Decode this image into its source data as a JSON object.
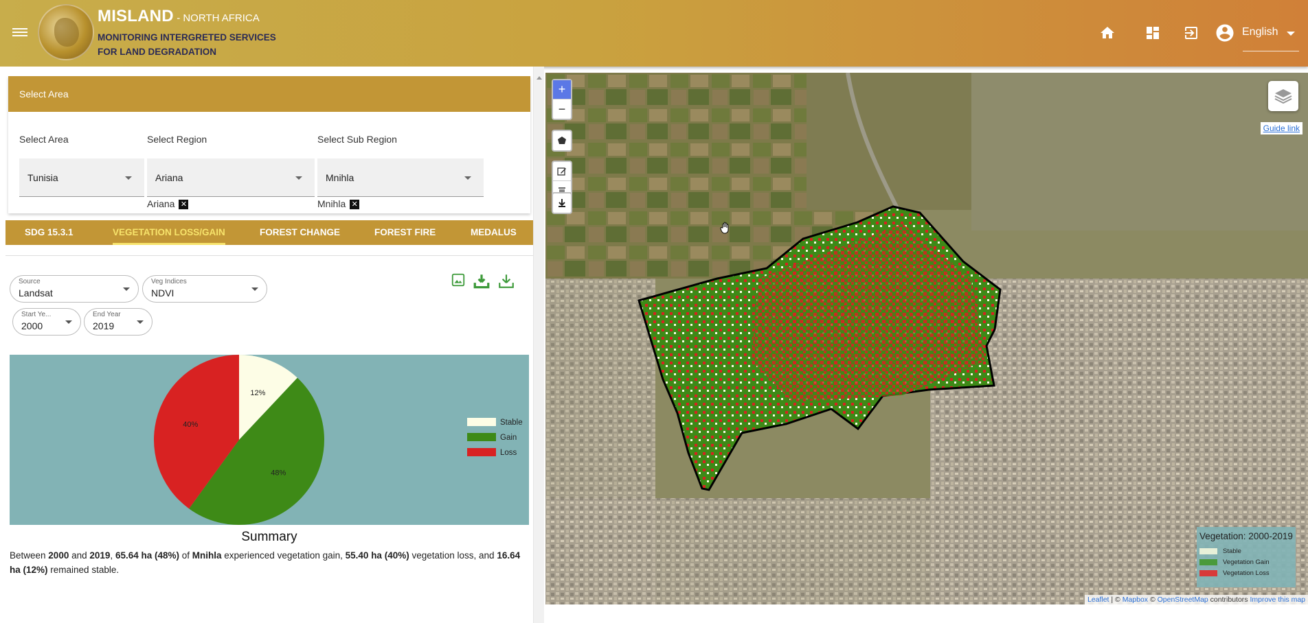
{
  "header": {
    "title": "MISLAND",
    "title_suffix": "- NORTH AFRICA",
    "subtitle_line1": "MONITORING INTERGRETED SERVICES",
    "subtitle_line2": "FOR LAND DEGRADATION",
    "icons": [
      "menu-icon",
      "home-icon",
      "dashboard-icon",
      "logout-icon",
      "account-icon"
    ],
    "language": "English"
  },
  "area_card": {
    "heading": "Select Area",
    "labels": {
      "area": "Select Area",
      "region": "Select Region",
      "sub_region": "Select Sub Region"
    },
    "values": {
      "area": "Tunisia",
      "region": "Ariana",
      "sub_region": "Mnihla"
    },
    "chips": {
      "region": "Ariana",
      "sub_region": "Mnihla"
    },
    "chip_close": "✕"
  },
  "tabs": [
    {
      "label": "SDG 15.3.1"
    },
    {
      "label": "VEGETATION LOSS/GAIN",
      "active": true
    },
    {
      "label": "FOREST CHANGE"
    },
    {
      "label": "FOREST FIRE"
    },
    {
      "label": "MEDALUS"
    }
  ],
  "filters": {
    "source": {
      "label": "Source",
      "value": "Landsat"
    },
    "veg_indices": {
      "label": "Veg Indices",
      "value": "NDVI"
    },
    "start_year": {
      "label": "Start Ye...",
      "value": "2000"
    },
    "end_year": {
      "label": "End Year",
      "value": "2019"
    }
  },
  "chart_data": {
    "type": "pie",
    "categories": [
      "Stable",
      "Gain",
      "Loss"
    ],
    "values": [
      12,
      48,
      40
    ],
    "labels": [
      "12%",
      "48%",
      "40%"
    ],
    "colors": [
      "#fdfde6",
      "#3e8a17",
      "#d82222"
    ],
    "legend_position": "right"
  },
  "summary": {
    "title": "Summary",
    "t1": "Between ",
    "b1": "2000",
    "t2": " and ",
    "b2": "2019",
    "t3": ", ",
    "b3": "65.64 ha (48%)",
    "t4": " of ",
    "b4": "Mnihla",
    "t5": " experienced vegetation gain, ",
    "b5": "55.40 ha (40%)",
    "t6": " vegetation loss, and ",
    "b6": "16.64 ha (12%)",
    "t7": " remained stable."
  },
  "map": {
    "zoom_in": "+",
    "zoom_out": "−",
    "guide_link": "Guide link",
    "legend": {
      "title": "Vegetation: 2000-2019",
      "items": [
        {
          "label": "Stable",
          "color": "#e8f0d8"
        },
        {
          "label": "Vegetation Gain",
          "color": "#4a9a3a"
        },
        {
          "label": "Vegetation Loss",
          "color": "#d83a3a"
        }
      ]
    },
    "attribution": {
      "leaflet": "Leaflet",
      "sep1": " | © ",
      "mapbox": "Mapbox",
      "sep2": " © ",
      "osm": "OpenStreetMap",
      "sep3": " contributors ",
      "improve": "Improve this map"
    }
  }
}
